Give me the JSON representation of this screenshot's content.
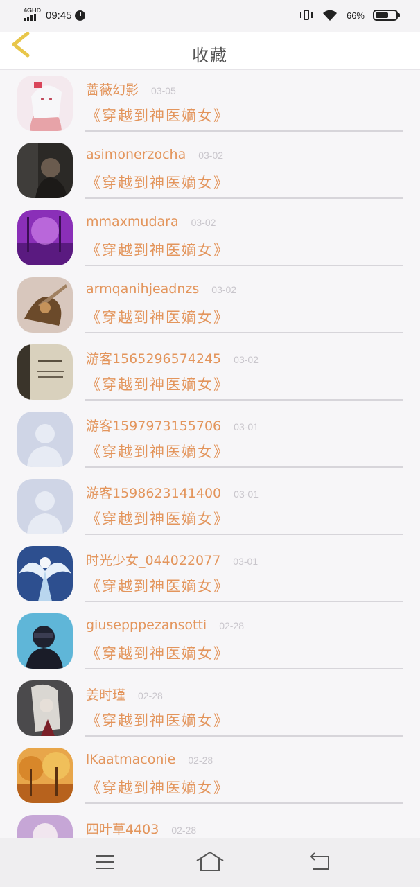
{
  "status_bar": {
    "network": "4GHD",
    "time": "09:45",
    "battery_percent": "66%",
    "battery_level": 0.66
  },
  "header": {
    "title": "收藏",
    "back_icon": "chevron-left-icon"
  },
  "items": [
    {
      "name": "蔷薇幻影",
      "date": "03-05",
      "book": "《穿越到神医嫡女》",
      "avatar": "anime-girl-pink"
    },
    {
      "name": "asimonerzocha",
      "date": "03-02",
      "book": "《穿越到神医嫡女》",
      "avatar": "dark-portrait"
    },
    {
      "name": "mmaxmudara",
      "date": "03-02",
      "book": "《穿越到神医嫡女》",
      "avatar": "purple-forest"
    },
    {
      "name": "armqanihjeadnzs",
      "date": "03-02",
      "book": "《穿越到神医嫡女》",
      "avatar": "warrior-brown"
    },
    {
      "name": "游客1565296574245",
      "date": "03-02",
      "book": "《穿越到神医嫡女》",
      "avatar": "beige-text"
    },
    {
      "name": "游客1597973155706",
      "date": "03-01",
      "book": "《穿越到神医嫡女》",
      "avatar": "default-user"
    },
    {
      "name": "游客1598623141400",
      "date": "03-01",
      "book": "《穿越到神医嫡女》",
      "avatar": "default-user"
    },
    {
      "name": "时光少女_044022077",
      "date": "03-01",
      "book": "《穿越到神医嫡女》",
      "avatar": "angel-blue"
    },
    {
      "name": "giusepppezansotti",
      "date": "02-28",
      "book": "《穿越到神医嫡女》",
      "avatar": "masked-man"
    },
    {
      "name": "姜时瑾",
      "date": "02-28",
      "book": "《穿越到神医嫡女》",
      "avatar": "silver-hair"
    },
    {
      "name": "lKaatmaconie",
      "date": "02-28",
      "book": "《穿越到神医嫡女》",
      "avatar": "autumn-trees"
    },
    {
      "name": "四叶草4403",
      "date": "02-28",
      "book": "",
      "avatar": "pink-partial"
    }
  ],
  "nav": {
    "menu_icon": "menu-icon",
    "home_icon": "home-icon",
    "back_icon": "back-icon"
  },
  "colors": {
    "accent": "#e3955c",
    "back_arrow": "#e8c64a",
    "date": "#c9c6cc",
    "background": "#f7f6f8"
  }
}
